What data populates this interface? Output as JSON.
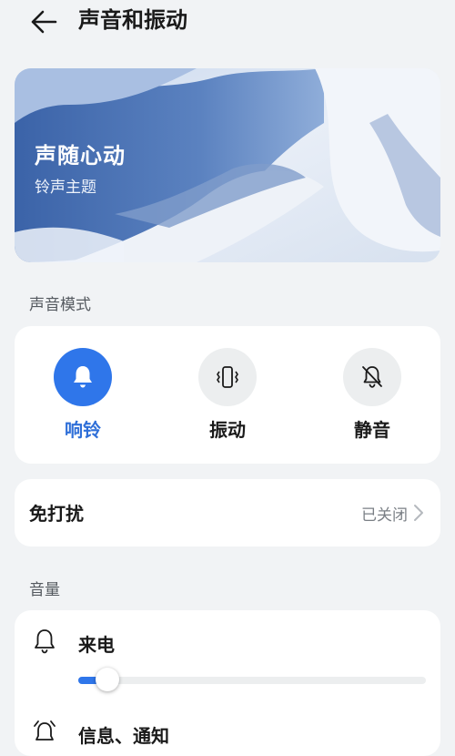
{
  "header": {
    "title": "声音和振动",
    "back_icon": "back-arrow-icon"
  },
  "banner": {
    "title": "声随心动",
    "subtitle": "铃声主题"
  },
  "sound_mode": {
    "section_label": "声音模式",
    "modes": [
      {
        "label": "响铃",
        "icon": "bell-icon",
        "active": true
      },
      {
        "label": "振动",
        "icon": "vibrate-icon",
        "active": false
      },
      {
        "label": "静音",
        "icon": "bell-off-icon",
        "active": false
      }
    ]
  },
  "do_not_disturb": {
    "label": "免打扰",
    "status": "已关闭"
  },
  "volume": {
    "section_label": "音量",
    "items": [
      {
        "label": "来电",
        "icon": "bell-outline-icon",
        "level": 0.06
      },
      {
        "label": "信息、通知",
        "icon": "alarm-icon"
      }
    ]
  },
  "colors": {
    "accent": "#2f76ea",
    "background": "#f1f3f5",
    "card": "#ffffff"
  }
}
